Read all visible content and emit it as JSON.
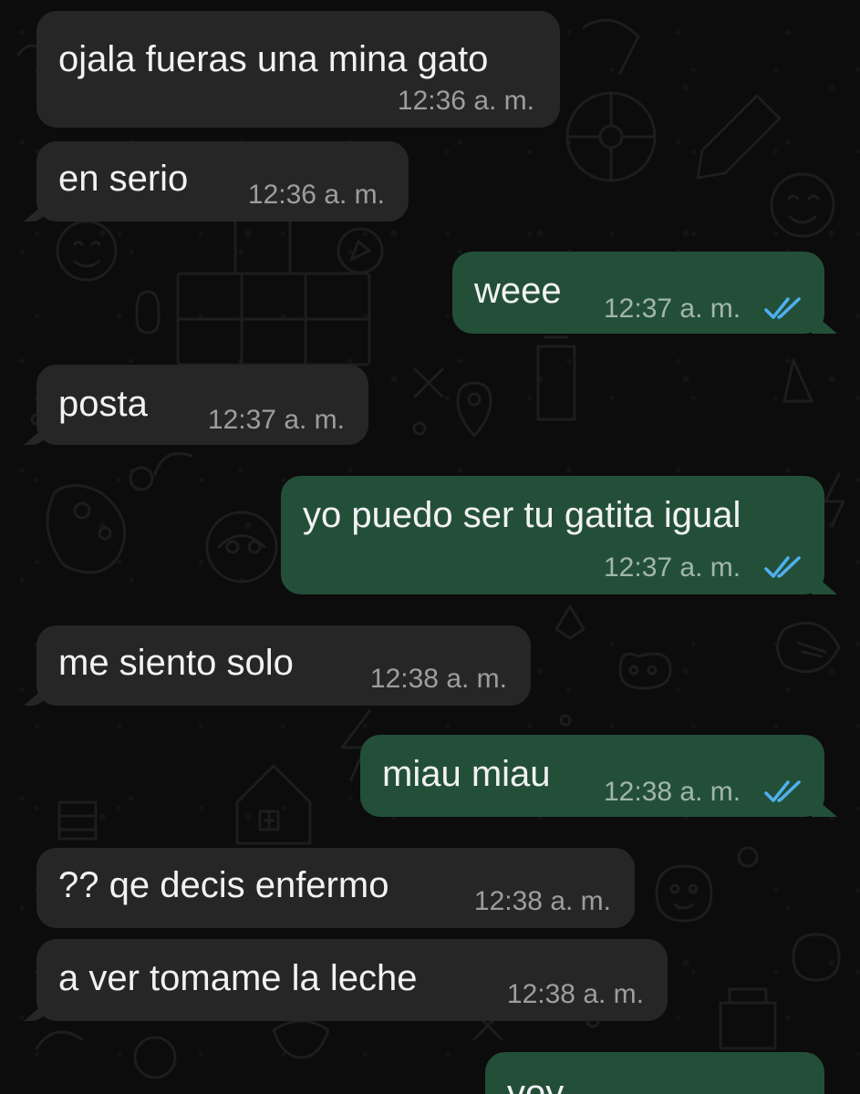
{
  "colors": {
    "background": "#0c0c0c",
    "incoming_bubble": "#262626",
    "outgoing_bubble": "#234f39",
    "read_ticks": "#4fb0f0"
  },
  "messages": [
    {
      "direction": "incoming",
      "text": "ojala fueras una mina gato",
      "time": "12:36 a. m."
    },
    {
      "direction": "incoming",
      "text": "en serio",
      "time": "12:36 a. m."
    },
    {
      "direction": "outgoing",
      "text": "weee",
      "time": "12:37 a. m.",
      "status": "read-double-check-icon"
    },
    {
      "direction": "incoming",
      "text": "posta",
      "time": "12:37 a. m."
    },
    {
      "direction": "outgoing",
      "text": "yo puedo ser tu gatita igual",
      "time": "12:37 a. m.",
      "status": "read-double-check-icon"
    },
    {
      "direction": "incoming",
      "text": "me siento solo",
      "time": "12:38 a. m."
    },
    {
      "direction": "outgoing",
      "text": "miau miau",
      "time": "12:38 a. m.",
      "status": "read-double-check-icon"
    },
    {
      "direction": "incoming",
      "text": "?? qe decis enfermo",
      "time": "12:38 a. m."
    },
    {
      "direction": "incoming",
      "text": "a ver tomame la leche",
      "time": "12:38 a. m."
    },
    {
      "direction": "outgoing",
      "text": "voy",
      "time": ""
    }
  ]
}
